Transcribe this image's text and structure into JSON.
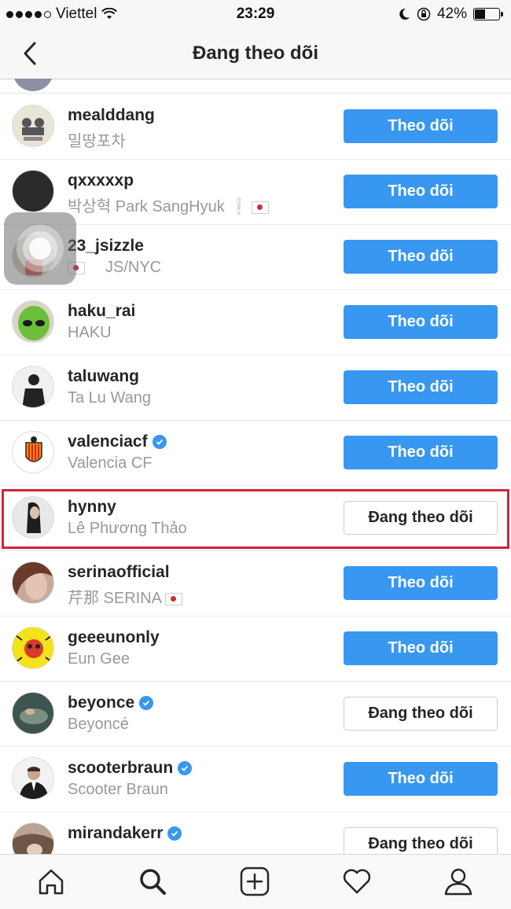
{
  "status_bar": {
    "carrier": "Viettel",
    "time": "23:29",
    "battery": "42%",
    "battery_level": 0.42
  },
  "header": {
    "title": "Đang theo dõi",
    "back_icon": "chevron-left-icon"
  },
  "rows": [
    {
      "username": "mealddang",
      "fullname": "밀땅포차",
      "verified": false,
      "button": "Theo dõi",
      "state": "follow"
    },
    {
      "username": "qxxxxxp",
      "fullname": "박상혁 Park SangHyuk ❕",
      "flag": "kr",
      "verified": false,
      "button": "Theo dõi",
      "state": "follow"
    },
    {
      "username": "23_jsizzle",
      "fullname": "JS/NYC",
      "flag_before": "kr",
      "verified": false,
      "button": "Theo dõi",
      "state": "follow"
    },
    {
      "username": "haku_rai",
      "fullname": "HAKU",
      "verified": false,
      "button": "Theo dõi",
      "state": "follow"
    },
    {
      "username": "taluwang",
      "fullname": "Ta Lu Wang",
      "verified": false,
      "button": "Theo dõi",
      "state": "follow"
    },
    {
      "username": "valenciacf",
      "fullname": "Valencia CF",
      "verified": true,
      "button": "Theo dõi",
      "state": "follow"
    },
    {
      "username": "hynny",
      "fullname": "Lê Phương Thảo",
      "verified": false,
      "button": "Đang theo dõi",
      "state": "following",
      "highlighted": true
    },
    {
      "username": "serinaofficial",
      "fullname": "芹那 SERINA",
      "flag": "jp",
      "verified": false,
      "button": "Theo dõi",
      "state": "follow"
    },
    {
      "username": "geeeunonly",
      "fullname": "Eun Gee",
      "verified": false,
      "button": "Theo dõi",
      "state": "follow"
    },
    {
      "username": "beyonce",
      "fullname": "Beyoncé",
      "verified": true,
      "button": "Đang theo dõi",
      "state": "following"
    },
    {
      "username": "scooterbraun",
      "fullname": "Scooter Braun",
      "verified": true,
      "button": "Theo dõi",
      "state": "follow"
    },
    {
      "username": "mirandakerr",
      "fullname": "",
      "verified": true,
      "button": "Đang theo dõi",
      "state": "following"
    }
  ],
  "tab_bar": [
    "home-icon",
    "search-icon",
    "add-post-icon",
    "heart-icon",
    "profile-icon"
  ],
  "colors": {
    "follow_blue": "#3897f0",
    "highlight_red": "#d4223b",
    "text_dark": "#262626",
    "text_gray": "#999999"
  }
}
